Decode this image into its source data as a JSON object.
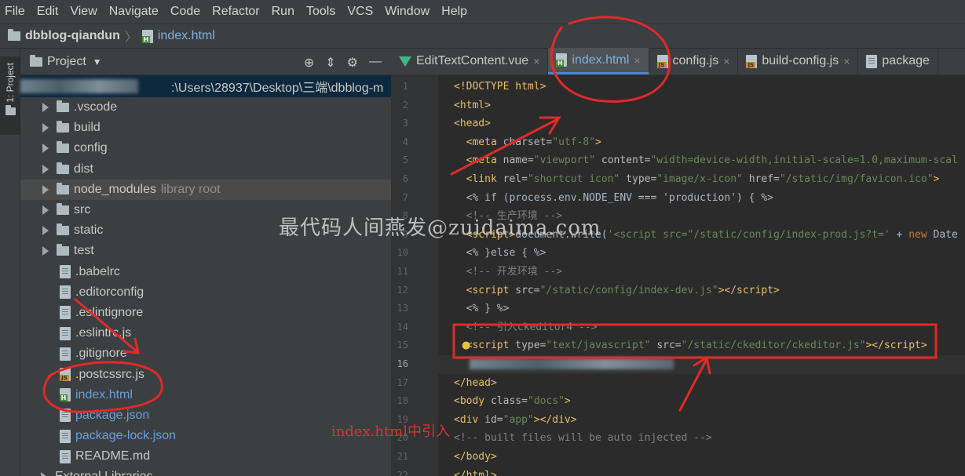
{
  "menubar": {
    "items": [
      "File",
      "Edit",
      "View",
      "Navigate",
      "Code",
      "Refactor",
      "Run",
      "Tools",
      "VCS",
      "Window",
      "Help"
    ]
  },
  "breadcrumb": {
    "project": "dbblog-qiandun",
    "file": "index.html"
  },
  "sidebar_tab": {
    "label": "1: Project"
  },
  "project_panel": {
    "header": "Project",
    "root_path": ":\\Users\\28937\\Desktop\\三端\\dbblog-m",
    "items": [
      {
        "label": ".vscode",
        "kind": "folder"
      },
      {
        "label": "build",
        "kind": "folder"
      },
      {
        "label": "config",
        "kind": "folder"
      },
      {
        "label": "dist",
        "kind": "folder"
      },
      {
        "label": "node_modules",
        "kind": "folder",
        "note": "library root"
      },
      {
        "label": "src",
        "kind": "folder"
      },
      {
        "label": "static",
        "kind": "folder"
      },
      {
        "label": "test",
        "kind": "folder"
      },
      {
        "label": ".babelrc",
        "kind": "file"
      },
      {
        "label": ".editorconfig",
        "kind": "file"
      },
      {
        "label": ".eslintignore",
        "kind": "file"
      },
      {
        "label": ".eslintrc.js",
        "kind": "file"
      },
      {
        "label": ".gitignore",
        "kind": "file"
      },
      {
        "label": ".postcssrc.js",
        "kind": "js"
      },
      {
        "label": "index.html",
        "kind": "html"
      },
      {
        "label": "package.json",
        "kind": "file"
      },
      {
        "label": "package-lock.json",
        "kind": "file"
      },
      {
        "label": "README.md",
        "kind": "file"
      },
      {
        "label": "External Libraries",
        "kind": "lib"
      }
    ]
  },
  "editor_tabs": [
    {
      "label": "EditTextContent.vue",
      "icon": "vue-icon"
    },
    {
      "label": "index.html",
      "icon": "html-icon",
      "active": true
    },
    {
      "label": "config.js",
      "icon": "js-icon"
    },
    {
      "label": "build-config.js",
      "icon": "js-icon"
    },
    {
      "label": "package",
      "icon": "file-icon"
    }
  ],
  "code_lines": [
    {
      "n": "1",
      "html": "<span class=\"tag\">&lt;!DOCTYPE html&gt;</span>"
    },
    {
      "n": "2",
      "html": "<span class=\"tag\">&lt;html&gt;</span>"
    },
    {
      "n": "3",
      "html": "<span class=\"tag\">&lt;head&gt;</span>"
    },
    {
      "n": "4",
      "html": "  <span class=\"tag\">&lt;meta </span><span class=\"attr\">charset=</span><span class=\"val\">\"utf-8\"</span><span class=\"tag\">&gt;</span>"
    },
    {
      "n": "5",
      "html": "  <span class=\"tag\">&lt;meta </span><span class=\"attr\">name=</span><span class=\"val\">\"viewport\"</span> <span class=\"attr\">content=</span><span class=\"val\">\"width=device-width,initial-scale=1.0,maximum-scal</span>"
    },
    {
      "n": "6",
      "html": "  <span class=\"tag\">&lt;link </span><span class=\"attr\">rel=</span><span class=\"val\">\"shortcut icon\"</span> <span class=\"attr\">type=</span><span class=\"val\">\"image/x-icon\"</span> <span class=\"attr\">href=</span><span class=\"val\">\"/static/img/favicon.ico\"</span><span class=\"tag\">&gt;</span>"
    },
    {
      "n": "7",
      "html": "  &lt;% if (process.env.NODE_ENV === 'production') { %&gt;"
    },
    {
      "n": "8",
      "html": "  <span class=\"com\">&lt;!-- 生产环境 --&gt;</span>"
    },
    {
      "n": "9",
      "html": "  <span class=\"tag\">&lt;script&gt;</span>document.write(<span class=\"val\">'&lt;script src=\"/static/config/index-prod.js?t='</span> + <span class=\"kw\">new</span> Date"
    },
    {
      "n": "10",
      "html": "  &lt;% }else { %&gt;"
    },
    {
      "n": "11",
      "html": "  <span class=\"com\">&lt;!-- 开发环境 --&gt;</span>"
    },
    {
      "n": "12",
      "html": "  <span class=\"tag\">&lt;script </span><span class=\"attr\">src=</span><span class=\"val\">\"/static/config/index-dev.js\"</span><span class=\"tag\">&gt;&lt;/script&gt;</span>"
    },
    {
      "n": "13",
      "html": "  &lt;% } %&gt;"
    },
    {
      "n": "14",
      "html": "  <span class=\"com\">&lt;!-- 引入ckeditor4 --&gt;</span>"
    },
    {
      "n": "15",
      "html": "  <span class=\"tag\">&lt;script </span><span class=\"attr\">type=</span><span class=\"val\">\"text/javascript\"</span> <span class=\"attr\">src=</span><span class=\"val\">\"/static/ckeditor/ckeditor.js\"</span><span class=\"tag\">&gt;&lt;/script&gt;</span>"
    },
    {
      "n": "16",
      "html": ""
    },
    {
      "n": "17",
      "html": "<span class=\"tag\">&lt;/head&gt;</span>"
    },
    {
      "n": "18",
      "html": "<span class=\"tag\">&lt;body </span><span class=\"attr\">class=</span><span class=\"val\">\"docs\"</span><span class=\"tag\">&gt;</span>"
    },
    {
      "n": "19",
      "html": "<span class=\"tag\">&lt;div </span><span class=\"attr\">id=</span><span class=\"val\">\"app\"</span><span class=\"tag\">&gt;&lt;/div&gt;</span>"
    },
    {
      "n": "20",
      "html": "<span class=\"com\">&lt;!-- built files will be auto injected --&gt;</span>"
    },
    {
      "n": "21",
      "html": "<span class=\"tag\">&lt;/body&gt;</span>"
    },
    {
      "n": "22",
      "html": "<span class=\"tag\">&lt;/html&gt;</span>"
    }
  ],
  "watermark": "最代码人间燕发@zuidaima.com",
  "annotation": "index.html中引入",
  "colors": {
    "annotation_red": "#e02a2a",
    "accent": "#4a88c7"
  }
}
